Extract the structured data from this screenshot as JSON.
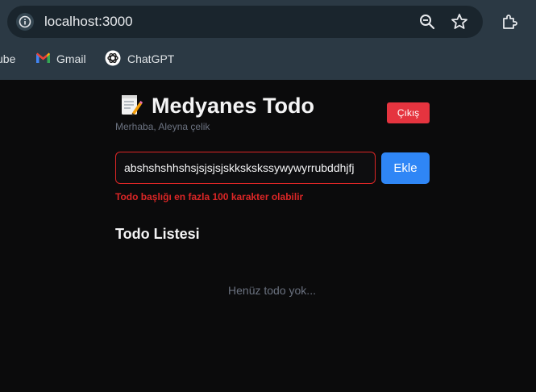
{
  "browser": {
    "url": "localhost:3000",
    "bookmarks": [
      {
        "label": "ube",
        "icon": "youtube-icon"
      },
      {
        "label": "Gmail",
        "icon": "gmail-icon"
      },
      {
        "label": "ChatGPT",
        "icon": "chatgpt-icon"
      }
    ],
    "colors": {
      "toolbar": "#2b3944",
      "omnibox": "#1a252d"
    }
  },
  "app": {
    "icon": "memo-icon",
    "title": "Medyanes Todo",
    "greeting": "Merhaba, Aleyna çelik",
    "logout_label": "Çıkış",
    "input_value": "abshshshhshsjsjsjsjskkskskssywywyrrubddhjfj",
    "add_label": "Ekle",
    "error_message": "Todo başlığı en fazla 100 karakter olabilir",
    "list_heading": "Todo Listesi",
    "empty_message": "Henüz todo yok...",
    "colors": {
      "background": "#0b0b0c",
      "danger": "#e5343f",
      "primary": "#2f86f6",
      "error_text": "#dc2626"
    }
  }
}
